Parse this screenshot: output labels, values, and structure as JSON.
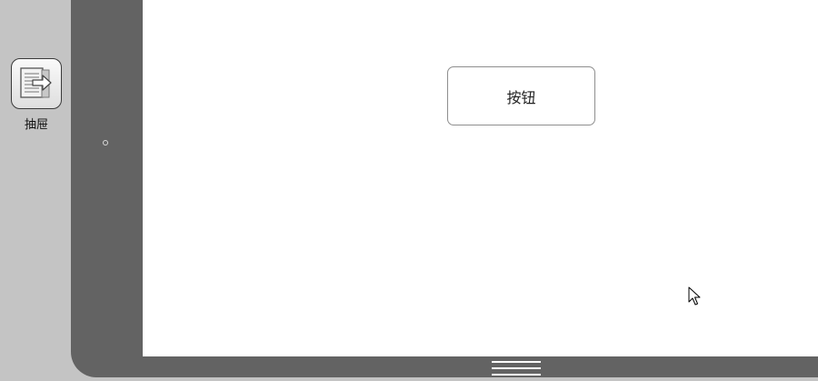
{
  "toolbar": {
    "items": [
      {
        "label": "抽屉",
        "icon": "drawer-icon"
      }
    ]
  },
  "canvas": {
    "button_label": "按钮"
  },
  "colors": {
    "panel": "#c4c4c4",
    "device_frame": "#636363",
    "screen": "#ffffff",
    "button_border": "#8e8e8e"
  }
}
